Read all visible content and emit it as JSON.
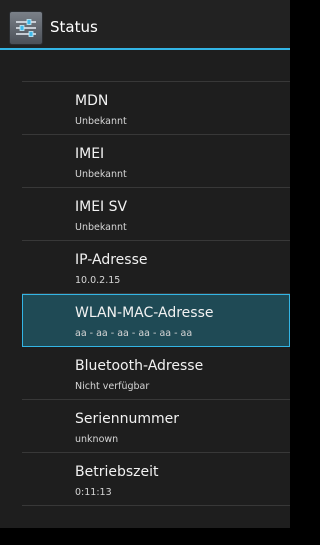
{
  "actionbar": {
    "title": "Status",
    "icon": "settings-sliders-icon"
  },
  "items": [
    {
      "title": "MDN",
      "summary": "Unbekannt"
    },
    {
      "title": "IMEI",
      "summary": "Unbekannt"
    },
    {
      "title": "IMEI SV",
      "summary": "Unbekannt"
    },
    {
      "title": "IP-Adresse",
      "summary": "10.0.2.15"
    },
    {
      "title": "WLAN-MAC-Adresse",
      "summary": "aa - aa - aa - aa - aa - aa",
      "selected": true
    },
    {
      "title": "Bluetooth-Adresse",
      "summary": "Nicht verfügbar"
    },
    {
      "title": "Seriennummer",
      "summary": "unknown"
    },
    {
      "title": "Betriebszeit",
      "summary": "0:11:13"
    }
  ],
  "colors": {
    "accent": "#33b5e5",
    "selected_bg": "#1f4a55"
  }
}
